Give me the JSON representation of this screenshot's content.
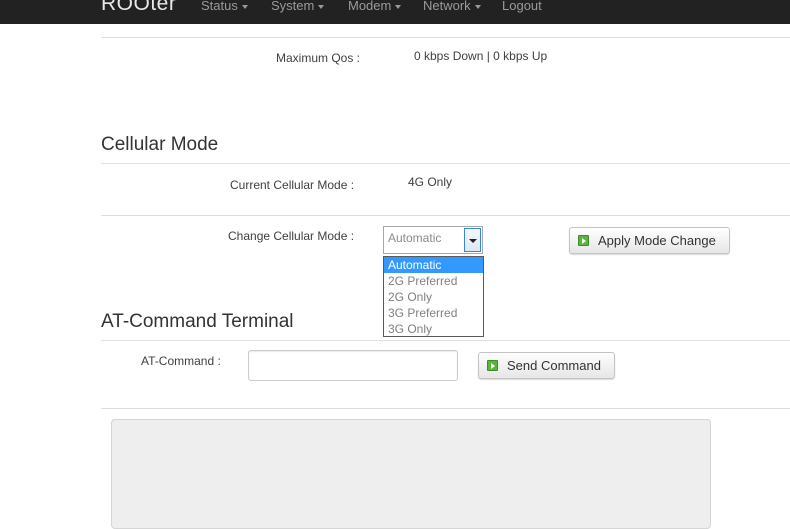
{
  "navbar": {
    "brand": "ROOter",
    "items": [
      {
        "label": "Status",
        "dropdown": true
      },
      {
        "label": "System",
        "dropdown": true
      },
      {
        "label": "Modem",
        "dropdown": true
      },
      {
        "label": "Network",
        "dropdown": true
      },
      {
        "label": "Logout",
        "dropdown": false
      }
    ]
  },
  "qos": {
    "label": "Maximum Qos :",
    "value": "0 kbps Down | 0 kbps Up"
  },
  "cellular": {
    "title": "Cellular Mode",
    "current_label": "Current Cellular Mode :",
    "current_value": "4G Only",
    "change_label": "Change Cellular Mode :",
    "select_value": "Automatic",
    "options": [
      "Automatic",
      "2G Preferred",
      "2G Only",
      "3G Preferred",
      "3G Only"
    ],
    "selected_index": 0,
    "apply_button": "Apply Mode Change"
  },
  "at_terminal": {
    "title": "AT-Command Terminal",
    "command_label": "AT-Command :",
    "command_value": "",
    "send_button": "Send Command"
  },
  "colors": {
    "navbar_bg": "#222222",
    "selection": "#3399ff",
    "button_icon": "#5cb33e"
  }
}
